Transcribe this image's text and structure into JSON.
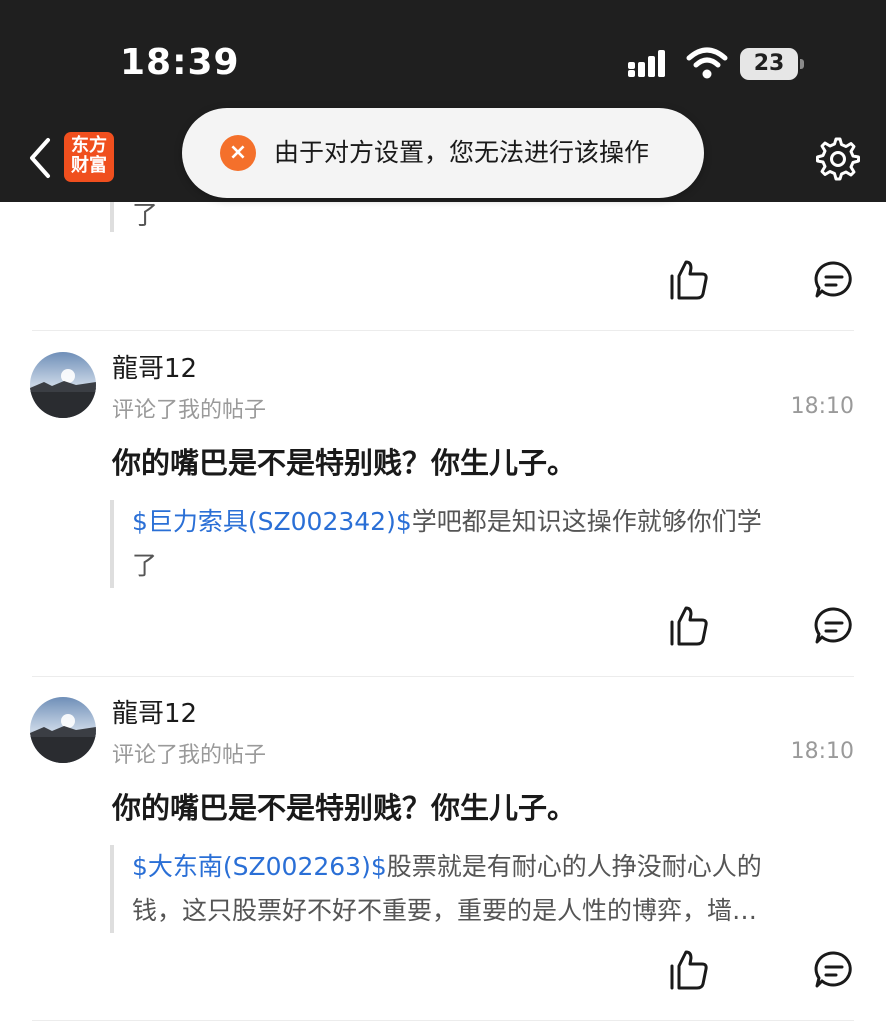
{
  "status_bar": {
    "time": "18:39",
    "battery": "23"
  },
  "header": {
    "logo_line1": "东方",
    "logo_line2": "财富",
    "back_icon": "chevron-left-icon",
    "settings_icon": "gear-icon"
  },
  "toast": {
    "icon": "×",
    "message": "由于对方设置，您无法进行该操作"
  },
  "feed": {
    "partial_quote_tail": "了",
    "items": [
      {
        "username": "龍哥12",
        "subtitle": "评论了我的帖子",
        "time": "18:10",
        "content": "你的嘴巴是不是特别贱？你生儿子。",
        "quote_stock": "$巨力索具(SZ002342)$",
        "quote_line1_rest": "学吧都是知识这操作就够你们学",
        "quote_line2": "了"
      },
      {
        "username": "龍哥12",
        "subtitle": "评论了我的帖子",
        "time": "18:10",
        "content": "你的嘴巴是不是特别贱？你生儿子。",
        "quote_stock": "$大东南(SZ002263)$",
        "quote_line1_rest": "股票就是有耐心的人挣没耐心人的",
        "quote_line2": "钱，这只股票好不好不重要，重要的是人性的博弈，墙…"
      }
    ]
  },
  "colors": {
    "header_bg": "#1f1f1f",
    "stock_link": "#2a6fd6",
    "toast_icon": "#f4702b",
    "logo_bg": "#f04f1e"
  }
}
